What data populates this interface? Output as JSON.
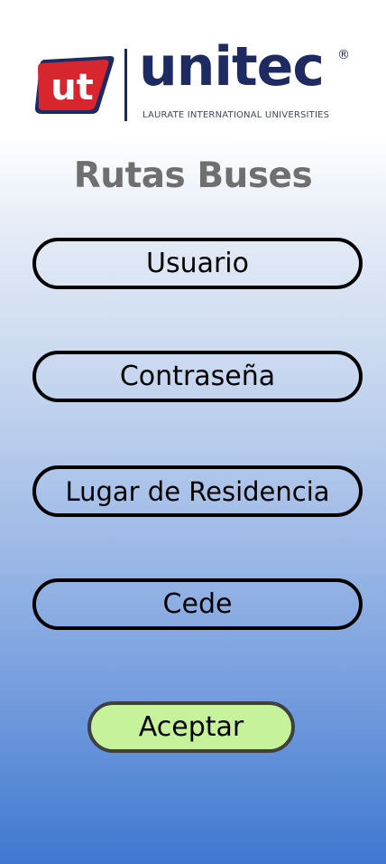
{
  "logo": {
    "badge_text": "ut",
    "wordmark": "unitec",
    "registered_mark": "®",
    "tagline": "LAURATE INTERNATIONAL UNIVERSITIES"
  },
  "page_title": "Rutas Buses",
  "form": {
    "username_label": "Usuario",
    "password_label": "Contraseña",
    "residence_label": "Lugar de Residencia",
    "campus_label": "Cede"
  },
  "actions": {
    "accept_label": "Aceptar"
  },
  "colors": {
    "brand_red": "#d7262e",
    "brand_navy": "#1e2b63",
    "title_gray": "#6f6f6f",
    "accept_button": "#c6f29b",
    "gradient_bottom": "#3f78cf"
  }
}
